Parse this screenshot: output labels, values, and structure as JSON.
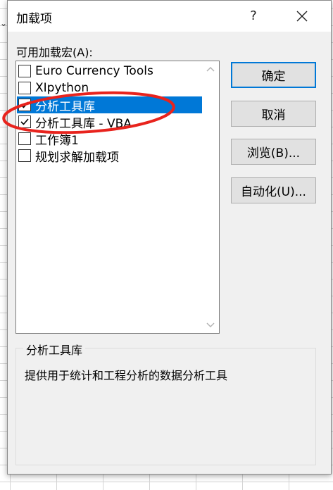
{
  "dialog": {
    "title": "加载项",
    "help_label": "?",
    "available_label": "可用加载宏(A):",
    "addins": [
      {
        "label": "Euro Currency Tools",
        "checked": false,
        "selected": false
      },
      {
        "label": "XIpython",
        "checked": false,
        "selected": false
      },
      {
        "label": "分析工具库",
        "checked": true,
        "selected": true
      },
      {
        "label": "分析工具库 - VBA",
        "checked": true,
        "selected": false
      },
      {
        "label": "工作簿1",
        "checked": false,
        "selected": false
      },
      {
        "label": "规划求解加载项",
        "checked": false,
        "selected": false
      }
    ],
    "buttons": {
      "ok": "确定",
      "cancel": "取消",
      "browse": "浏览(B)...",
      "automation": "自动化(U)..."
    },
    "description_group": {
      "title": "分析工具库",
      "text": "提供用于统计和工程分析的数据分析工具"
    }
  },
  "colors": {
    "selection": "#0078d7",
    "annotation_circle": "#e8231d",
    "dialog_bg": "#f0f0f0"
  },
  "icons": [
    "close-icon",
    "help-icon",
    "scroll-up-icon",
    "scroll-down-icon",
    "checkmark-icon"
  ]
}
